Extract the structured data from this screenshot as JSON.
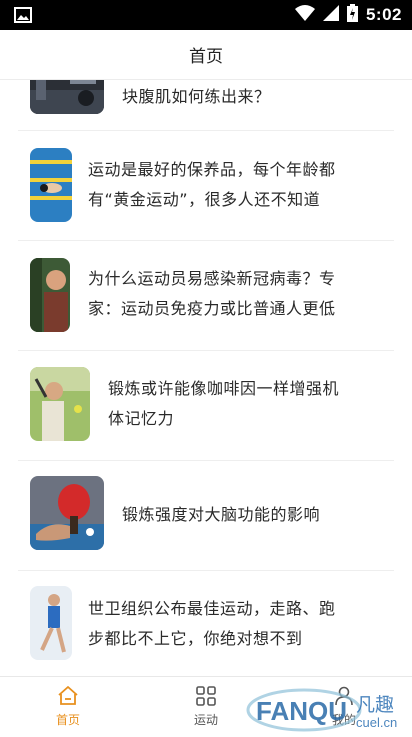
{
  "status_bar": {
    "time": "5:02"
  },
  "header": {
    "title": "首页"
  },
  "feed": {
    "items": [
      {
        "title_lines": [
          "块腹肌如何练出来？"
        ],
        "thumb": "gym-photo"
      },
      {
        "title_lines": [
          "运动是最好的保养品，每个年龄都",
          "有“黄金运动”，很多人还不知道"
        ],
        "thumb": "swimming-photo"
      },
      {
        "title_lines": [
          "为什么运动员易感染新冠病毒？专",
          "家：运动员免疫力或比普通人更低"
        ],
        "thumb": "athlete-photo"
      },
      {
        "title_lines": [
          "锻炼或许能像咖啡因一样增强机",
          "体记忆力"
        ],
        "thumb": "tennis-photo"
      },
      {
        "title_lines": [
          "锻炼强度对大脑功能的影响"
        ],
        "thumb": "pingpong-photo"
      },
      {
        "title_lines": [
          "世卫组织公布最佳运动，走路、跑",
          "步都比不上它，你绝对想不到"
        ],
        "thumb": "runner-photo"
      }
    ]
  },
  "bottom_nav": {
    "items": [
      {
        "label": "首页",
        "icon": "home-icon",
        "active": true
      },
      {
        "label": "运动",
        "icon": "grid-icon",
        "active": false
      },
      {
        "label": "我的",
        "icon": "person-icon",
        "active": false
      }
    ]
  },
  "watermark": {
    "brand": "FANQU",
    "cn": "凡趣",
    "domain": "cuel.cn"
  },
  "colors": {
    "accent": "#e8901e",
    "text": "#2a2a2a",
    "divider": "#eeeeee"
  }
}
